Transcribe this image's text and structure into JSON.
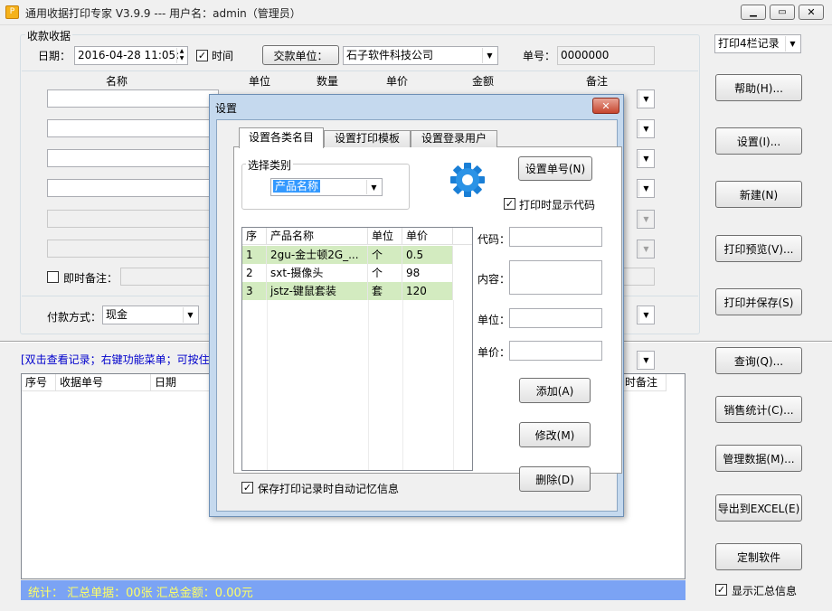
{
  "window": {
    "title": "通用收据打印专家 V3.9.9 --- 用户名：admin（管理员）"
  },
  "receipt": {
    "group_title": "收款收据",
    "date_label": "日期：",
    "date_value": "2016-04-28 11:05:",
    "time_label": "时间",
    "payer_button": "交款单位：",
    "payer_value": "石子软件科技公司",
    "number_label": "单号：",
    "number_value": "0000000",
    "headers": {
      "name": "名称",
      "unit": "单位",
      "qty": "数量",
      "price": "单价",
      "amount": "金额",
      "remark": "备注"
    },
    "instant_remark_label": "即时备注：",
    "payment_label": "付款方式：",
    "payment_value": "现金"
  },
  "records": {
    "hint": "[双击查看记录；右键功能菜单；可按住",
    "columns": [
      "序号",
      "收据单号",
      "日期",
      "时备注"
    ],
    "summary": "统计：   汇总单据：00张      汇总金额：0.00元"
  },
  "side": {
    "print_mode": "打印4栏记录",
    "buttons": [
      "帮助(H)...",
      "设置(I)...",
      "新建(N)",
      "打印预览(V)...",
      "打印并保存(S)",
      "查询(Q)...",
      "销售统计(C)...",
      "管理数据(M)...",
      "导出到EXCEL(E)",
      "定制软件"
    ],
    "show_summary": "显示汇总信息"
  },
  "dialog": {
    "title": "设置",
    "tabs": [
      "设置各类名目",
      "设置打印模板",
      "设置登录用户"
    ],
    "category_group": "选择类别",
    "category_value": "产品名称",
    "set_number_button": "设置单号(N)",
    "print_code_label": "打印时显示代码",
    "table_headers": [
      "序",
      "产品名称",
      "单位",
      "单价"
    ],
    "rows": [
      {
        "no": "1",
        "name": "2gu-金士顿2G_...",
        "unit": "个",
        "price": "0.5"
      },
      {
        "no": "2",
        "name": "sxt-摄像头",
        "unit": "个",
        "price": "98"
      },
      {
        "no": "3",
        "name": "jstz-键鼠套装",
        "unit": "套",
        "price": "120"
      }
    ],
    "code_label": "代码：",
    "content_label": "内容：",
    "unit_label": "单位：",
    "price_label": "单价：",
    "add_button": "添加(A)",
    "edit_button": "修改(M)",
    "delete_button": "删除(D)",
    "auto_remember_label": "保存打印记录时自动记忆信息"
  },
  "colors": {
    "summary_bg": "#7ba3f4",
    "summary_text": "#ffff66",
    "selected_blue": "#3399ff",
    "row_green": "#d3ebc0",
    "hint_blue": "#0000cc"
  }
}
